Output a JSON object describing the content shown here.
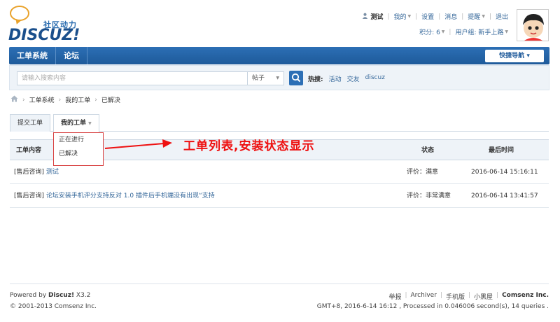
{
  "logo": {
    "tagline": "社区动力",
    "wordmark": "DISCUZ!"
  },
  "topbar": {
    "username": "测试",
    "menu": [
      "我的",
      "设置",
      "消息",
      "提醒",
      "退出"
    ],
    "points_label": "积分: 6",
    "group_label": "用户组: 新手上路"
  },
  "nav": {
    "items": [
      "工单系统",
      "论坛"
    ],
    "quick_nav": "快捷导航"
  },
  "search": {
    "placeholder": "请输入搜索内容",
    "type": "帖子",
    "hot_label": "热搜:",
    "hot_terms": [
      "活动",
      "交友",
      "discuz"
    ]
  },
  "breadcrumb": [
    "工单系统",
    "我的工单",
    "已解决"
  ],
  "tabs": {
    "submit": "提交工单",
    "mine": "我的工单"
  },
  "dropdown": [
    "正在进行",
    "已解决"
  ],
  "annotation": "工单列表,安装状态显示",
  "table": {
    "headers": {
      "content": "工单内容",
      "status": "状态",
      "time": "最后时间"
    },
    "rows": [
      {
        "category": "[售后咨询]",
        "title": "测试",
        "status": "评价：满意",
        "time": "2016-06-14 15:16:11"
      },
      {
        "category": "[售后咨询]",
        "title": "论坛安装手机评分支持反对 1.0 插件后手机端没有出现“支持",
        "status": "评价：非常满意",
        "time": "2016-06-14 13:41:57"
      }
    ]
  },
  "footer": {
    "powered": "Powered by",
    "brand": "Discuz!",
    "version": "X3.2",
    "copyright": "© 2001-2013 Comsenz Inc.",
    "links": [
      "举报",
      "Archiver",
      "手机版",
      "小黑屋"
    ],
    "company": "Comsenz Inc.",
    "stats": "GMT+8, 2016-6-14 16:12 , Processed in 0.046006 second(s), 14 queries ."
  },
  "colors": {
    "nav_blue": "#1e5a9a",
    "annotation_red": "#ee1111",
    "link": "#336699"
  }
}
